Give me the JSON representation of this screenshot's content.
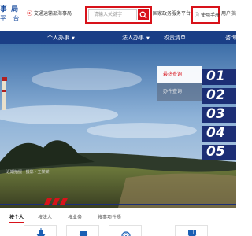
{
  "header": {
    "brand_line1": "事 局",
    "brand_line2": "平 台",
    "location": "交通运输部海事局",
    "search_placeholder": "请输入关键字",
    "gov_link": "国家政务服务平台",
    "manual_label": "使用手册",
    "user_link": "用户指南"
  },
  "nav": {
    "items": [
      "个人办事",
      "法人办事",
      "权责清单",
      "咨询"
    ]
  },
  "banner": {
    "caption": "近期拍摄 · 摄影 · 王某某",
    "tabs": [
      "最热查询",
      "办件查询"
    ],
    "ranks": [
      "01",
      "02",
      "03",
      "04",
      "05"
    ]
  },
  "service_tabs": [
    "按个人",
    "按法人",
    "按业务",
    "按事项性质"
  ],
  "service_icons": [
    "ship-icon",
    "vessel-icon",
    "radar-icon",
    "container-ship-icon"
  ],
  "colors": {
    "accent_red": "#d8121a",
    "nav_blue": "#1a3e86",
    "rank_navy": "#1c2e75"
  }
}
